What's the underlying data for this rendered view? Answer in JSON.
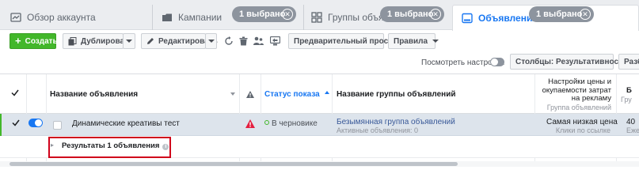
{
  "tabs": {
    "overview": {
      "label": "Обзор аккаунта",
      "icon": "home-icon"
    },
    "campaigns": {
      "label": "Кампании",
      "icon": "folder-icon",
      "badge": "1 выбрано"
    },
    "adsets": {
      "label": "Группы объяв",
      "icon": "grid-icon",
      "badge": "1 выбрано"
    },
    "ads": {
      "label": "Объявления",
      "icon": "ad-icon",
      "badge": "1 выбрано",
      "active": true
    }
  },
  "toolbar": {
    "create_label": "Создать",
    "duplicate_label": "Дублировать",
    "edit_label": "Редактировать",
    "preview_label": "Предварительный просмотр",
    "rules_label": "Правила",
    "icons": [
      "refresh-icon",
      "trash-icon",
      "people-icon",
      "share-icon"
    ]
  },
  "settings": {
    "preview_settings_label": "Посмотреть настройки",
    "columns_label": "Столбцы: Результативность",
    "breakdown_label": "Разб"
  },
  "table": {
    "headers": {
      "name": "Название объявления",
      "status": "Статус показа",
      "adset": "Название группы объявлений",
      "bid_strategy": "Настройки цены и окупаемости затрат на рекламу",
      "bid_strategy_sub": "Группа объявлений",
      "next": "Б",
      "next_sub": "Гру"
    },
    "rows": [
      {
        "name": "Динамические креативы тест",
        "status": "В черновике",
        "adset": "Безымянная группа объявлений",
        "adset_sub": "Активные объявления: 0",
        "bid": "Самая низкая цена",
        "bid_sub": "Клики по ссылке",
        "next": "40",
        "next_sub": "Еже"
      }
    ],
    "results": {
      "label": "Результаты 1 объявления"
    }
  },
  "colors": {
    "accent": "#1877f2",
    "create_green": "#42b72a",
    "warning_red": "#e41e3f",
    "highlight_box": "#d0021b",
    "selected_row": "#dde4ec"
  }
}
